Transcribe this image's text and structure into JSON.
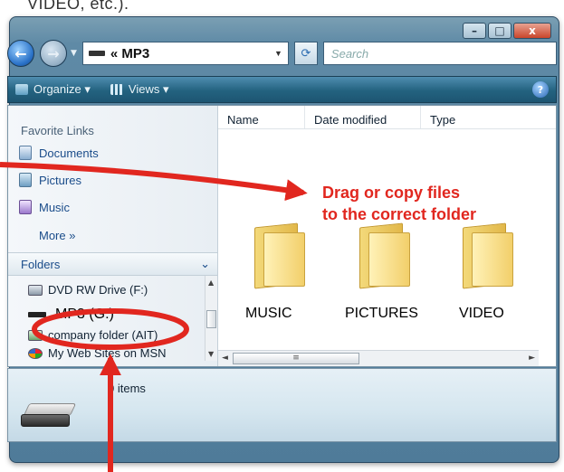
{
  "caption": "VIDEO, etc.).",
  "window": {
    "controls": {
      "minimize": "–",
      "maximize": "□",
      "close": "x"
    }
  },
  "nav": {
    "address": "« MP3",
    "search_placeholder": "Search"
  },
  "toolbar": {
    "organize": "Organize ▾",
    "views": "Views ▾",
    "help": "?"
  },
  "sidebar": {
    "favorite_title": "Favorite Links",
    "links": [
      {
        "label": "Documents",
        "icon": "documents-icon"
      },
      {
        "label": "Pictures",
        "icon": "pictures-icon"
      },
      {
        "label": "Music",
        "icon": "music-icon"
      }
    ],
    "more": "More »",
    "folders_title": "Folders",
    "folders_chevron": "⌄",
    "tree": [
      {
        "label": "DVD RW Drive (F:)"
      },
      {
        "label": "MP3  (G:)"
      },
      {
        "label": "company folder (AIT)"
      },
      {
        "label": "My Web Sites on MSN"
      }
    ]
  },
  "columns": [
    "Name",
    "Date modified",
    "Type"
  ],
  "folders": [
    "MUSIC",
    "PICTURES",
    "VIDEO"
  ],
  "details": {
    "items": "0 items"
  },
  "annotation": {
    "line1": "Drag or copy files",
    "line2": "to the correct folder",
    "color": "#e1271f"
  }
}
